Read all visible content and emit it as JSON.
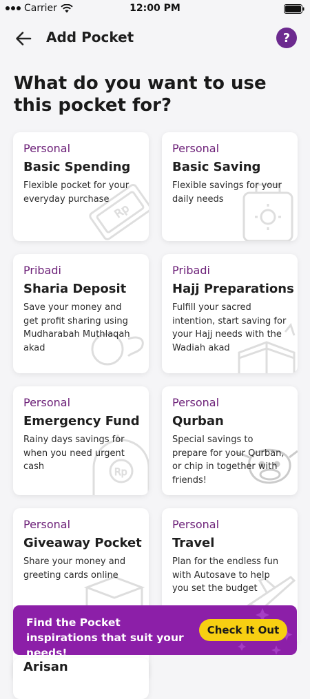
{
  "status_bar": {
    "carrier": "Carrier",
    "time": "12:00 PM"
  },
  "header": {
    "title": "Add Pocket",
    "help_label": "?"
  },
  "heading": "What do you want to use this pocket for?",
  "cards": [
    {
      "category": "Personal",
      "title": "Basic Spending",
      "description": "Flexible pocket for your everyday purchase"
    },
    {
      "category": "Personal",
      "title": "Basic Saving",
      "description": "Flexible savings for your daily needs"
    },
    {
      "category": "Pribadi",
      "title": "Sharia Deposit",
      "description": "Save your money and get profit sharing using Mudharabah Muthlaqah akad"
    },
    {
      "category": "Pribadi",
      "title": "Hajj Preparations",
      "description": "Fulfill your sacred intention, start saving for your Hajj needs with the Wadiah akad"
    },
    {
      "category": "Personal",
      "title": "Emergency Fund",
      "description": "Rainy days savings for when you need urgent cash"
    },
    {
      "category": "Personal",
      "title": "Qurban",
      "description": "Special savings to prepare for your Qurban, or chip in together with friends!"
    },
    {
      "category": "Personal",
      "title": "Giveaway Pocket",
      "description": "Share your money and greeting cards online"
    },
    {
      "category": "Personal",
      "title": "Travel",
      "description": "Plan for the endless fun with Autosave to help you set the budget"
    },
    {
      "title": "Arisan"
    }
  ],
  "banner": {
    "text": "Find the Pocket inspirations that suit your needs!",
    "cta_label": "Check It Out"
  },
  "colors": {
    "accent": "#6c2078",
    "banner": "#8c1fa8",
    "cta": "#f7cf12",
    "background": "#f5f5f7"
  }
}
